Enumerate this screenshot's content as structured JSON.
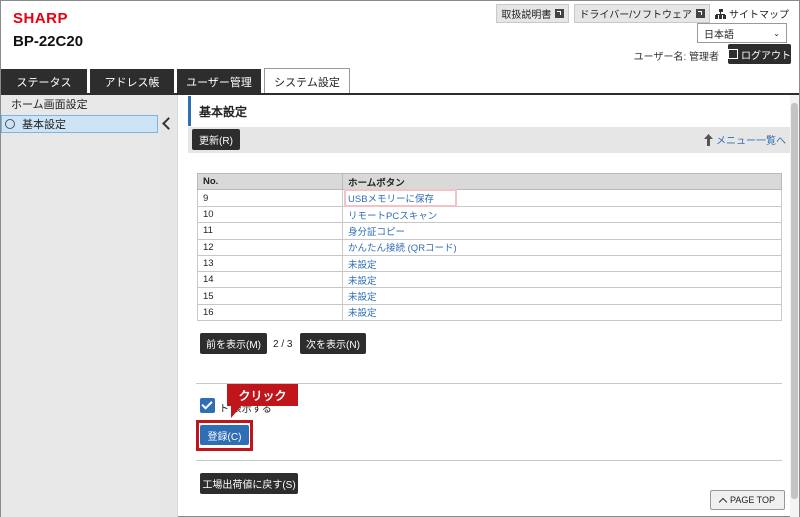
{
  "header": {
    "brand": "SHARP",
    "model": "BP-22C20",
    "links": [
      {
        "label": "取扱説明書",
        "icon": "external-icon"
      },
      {
        "label": "ドライバー/ソフトウェア",
        "icon": "external-icon"
      }
    ],
    "sitemap": "サイトマップ",
    "language": "日本語",
    "user": "ユーザー名: 管理者",
    "logout": "ログアウト"
  },
  "tabs": [
    {
      "label": "ステータス",
      "active": false
    },
    {
      "label": "アドレス帳",
      "active": false
    },
    {
      "label": "ユーザー管理",
      "active": false
    },
    {
      "label": "システム設定",
      "active": true
    }
  ],
  "sidebar": {
    "items": [
      {
        "label": "ホーム画面設定",
        "selected": false
      },
      {
        "label": "基本設定",
        "selected": true
      }
    ]
  },
  "main": {
    "title": "基本設定",
    "refresh": "更新(R)",
    "menu_link": "メニュー一覧へ",
    "table": {
      "headers": [
        "No.",
        "ホームボタン"
      ],
      "rows": [
        [
          "9",
          "USBメモリーに保存"
        ],
        [
          "10",
          "リモートPCスキャン"
        ],
        [
          "11",
          "身分証コピー"
        ],
        [
          "12",
          "かんたん接続 (QRコード)"
        ],
        [
          "13",
          "未設定"
        ],
        [
          "14",
          "未設定"
        ],
        [
          "15",
          "未設定"
        ],
        [
          "16",
          "未設定"
        ]
      ]
    },
    "prev": "前を表示(M)",
    "page_info": "2 / 3",
    "next": "次を表示(N)",
    "checkbox_label": "ト  表示する",
    "callout": "クリック",
    "register": "登録(C)",
    "factory_reset": "工場出荷値に戻す(S)",
    "page_top": "PAGE TOP"
  },
  "colors": {
    "brand": "#e60012",
    "accent": "#2f6db5",
    "callout": "#c0161b"
  }
}
